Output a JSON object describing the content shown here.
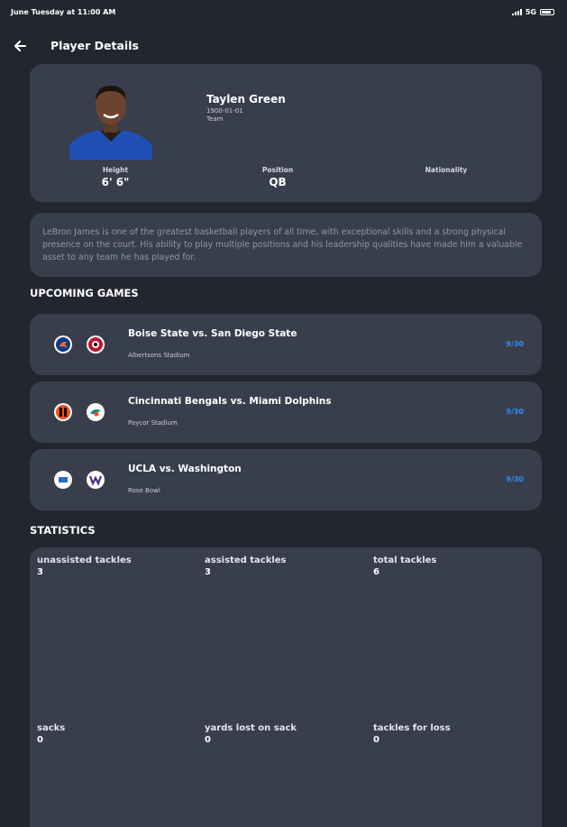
{
  "status_bar": {
    "time": "June Tuesday at 11:00 AM",
    "network": "5G"
  },
  "header": {
    "title": "Player Details"
  },
  "player": {
    "name": "Taylen Green",
    "dob": "1900-01-01",
    "team": "Team",
    "height_label": "Height",
    "height_value": "6' 6\"",
    "position_label": "Position",
    "position_value": "QB",
    "nationality_label": "Nationality",
    "nationality_value": "",
    "bio": "LeBron James is one of the greatest basketball players of all time, with exceptional skills and a strong physical presence on the court. His ability to play multiple positions and his leadership qualities have made him a valuable asset to any team he has played for."
  },
  "upcoming": {
    "heading": "UPCOMING GAMES",
    "games": [
      {
        "title": "Boise State vs. San Diego State",
        "venue": "Albertsons Stadium",
        "date": "9/30",
        "home_icon": "boise-state-logo-icon",
        "away_icon": "san-diego-state-logo-icon"
      },
      {
        "title": "Cincinnati Bengals vs. Miami Dolphins",
        "venue": "Paycor Stadium",
        "date": "9/30",
        "home_icon": "bengals-logo-icon",
        "away_icon": "dolphins-logo-icon"
      },
      {
        "title": "UCLA vs. Washington",
        "venue": "Rose Bowl",
        "date": "9/30",
        "home_icon": "ucla-logo-icon",
        "away_icon": "washington-logo-icon"
      }
    ]
  },
  "statistics": {
    "heading": "STATISTICS",
    "items": [
      {
        "label": "unassisted tackles",
        "value": "3"
      },
      {
        "label": "assisted tackles",
        "value": "3"
      },
      {
        "label": "total tackles",
        "value": "6"
      },
      {
        "label": "sacks",
        "value": "0"
      },
      {
        "label": "yards lost on sack",
        "value": "0"
      },
      {
        "label": "tackles for loss",
        "value": "0"
      }
    ]
  },
  "colors": {
    "background": "#23262f",
    "card": "#393e4c",
    "accent": "#2f8cf0"
  }
}
